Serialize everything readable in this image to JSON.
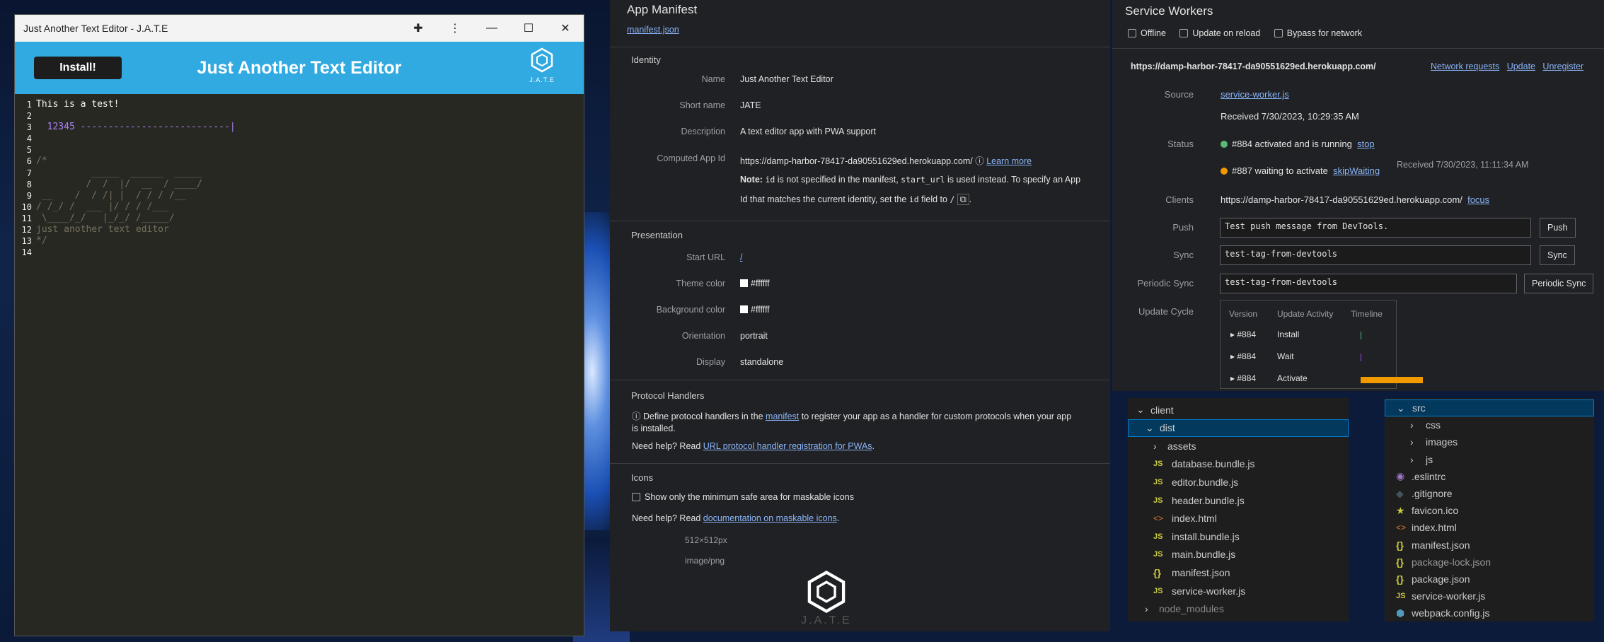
{
  "app": {
    "window_title": "Just Another Text Editor - J.A.T.E",
    "install_label": "Install!",
    "header_title": "Just Another Text Editor",
    "logo_text": "J.A.T.E",
    "lines": [
      {
        "n": "1",
        "text": "This is a test!",
        "cls": "code"
      },
      {
        "n": "2",
        "text": "",
        "cls": "code"
      },
      {
        "n": "3",
        "text": "  12345 ---------------------------|",
        "cls": "c-num"
      },
      {
        "n": "4",
        "text": "",
        "cls": "code"
      },
      {
        "n": "5",
        "text": "",
        "cls": "code"
      },
      {
        "n": "6",
        "text": "/*",
        "cls": "c-com"
      },
      {
        "n": "7",
        "text": "          _____  ______  _____",
        "cls": "c-com"
      },
      {
        "n": "8",
        "text": "         /  /  |/  __  / ____/",
        "cls": "c-com"
      },
      {
        "n": "9",
        "text": " __    /  / /| |  / / / /__",
        "cls": "c-com"
      },
      {
        "n": "10",
        "text": "/ /_/ /  ___ |/ / / /___",
        "cls": "c-com"
      },
      {
        "n": "11",
        "text": " \\____/_/   |_/_/ /_____/",
        "cls": "c-com"
      },
      {
        "n": "12",
        "text": "just another text editor",
        "cls": "c-com"
      },
      {
        "n": "13",
        "text": "*/",
        "cls": "c-com"
      },
      {
        "n": "14",
        "text": "",
        "cls": "code"
      }
    ]
  },
  "manifest": {
    "title": "App Manifest",
    "link": "manifest.json",
    "identity": {
      "heading": "Identity",
      "name_k": "Name",
      "name_v": "Just Another Text Editor",
      "short_k": "Short name",
      "short_v": "JATE",
      "desc_k": "Description",
      "desc_v": "A text editor app with PWA support",
      "appid_k": "Computed App Id",
      "appid_v": "https://damp-harbor-78417-da90551629ed.herokuapp.com/",
      "learn": "Learn more",
      "note_b": "Note:",
      "note_1": " is not specified in the manifest, ",
      "note_2": " is used instead. To specify an App",
      "note_3": "Id that matches the current identity, set the ",
      "note_4": " field to ",
      "note_5": ".",
      "code_id": "id",
      "code_start": "start_url",
      "code_id2": "id",
      "code_slash": "/"
    },
    "presentation": {
      "heading": "Presentation",
      "start_k": "Start URL",
      "start_v": "/",
      "theme_k": "Theme color",
      "theme_v": "#ffffff",
      "bg_k": "Background color",
      "bg_v": "#ffffff",
      "orient_k": "Orientation",
      "orient_v": "portrait",
      "display_k": "Display",
      "display_v": "standalone"
    },
    "protocol": {
      "heading": "Protocol Handlers",
      "line1a": "Define protocol handlers in the ",
      "line1link": "manifest",
      "line1b": " to register your app as a handler for custom protocols when your app",
      "line2": "is installed.",
      "help": "Need help? Read ",
      "helplink": "URL protocol handler registration for PWAs",
      "helpend": "."
    },
    "icons": {
      "heading": "Icons",
      "checkbox": "Show only the minimum safe area for maskable icons",
      "help": "Need help? Read ",
      "helplink": "documentation on maskable icons",
      "helpend": ".",
      "size": "512×512px",
      "type": "image/png",
      "logo_text": "J.A.T.E"
    }
  },
  "sw": {
    "title": "Service Workers",
    "offline": "Offline",
    "update_reload": "Update on reload",
    "bypass": "Bypass for network",
    "origin": "https://damp-harbor-78417-da90551629ed.herokuapp.com/",
    "netreq": "Network requests",
    "update": "Update",
    "unregister": "Unregister",
    "source_k": "Source",
    "source_v": "service-worker.js",
    "received": "Received 7/30/2023, 10:29:35 AM",
    "status_k": "Status",
    "status1": "#884 activated and is running",
    "stop": "stop",
    "status2": "#887 waiting to activate",
    "skip": "skipWaiting",
    "received2": "Received 7/30/2023, 11:11:34 AM",
    "clients_k": "Clients",
    "clients_v": "https://damp-harbor-78417-da90551629ed.herokuapp.com/",
    "focus": "focus",
    "push_k": "Push",
    "push_v": "Test push message from DevTools.",
    "push_btn": "Push",
    "sync_k": "Sync",
    "sync_v": "test-tag-from-devtools",
    "sync_btn": "Sync",
    "psync_k": "Periodic Sync",
    "psync_v": "test-tag-from-devtools",
    "psync_btn": "Periodic Sync",
    "cycle_k": "Update Cycle",
    "cycle_headers": [
      "Version",
      "Update Activity",
      "Timeline"
    ],
    "cycle_rows": [
      {
        "v": "#884",
        "a": "Install"
      },
      {
        "v": "#884",
        "a": "Wait"
      },
      {
        "v": "#884",
        "a": "Activate"
      }
    ],
    "colors": {
      "green": "#5bb974",
      "orange": "#f29900"
    }
  },
  "explorer1": {
    "items": [
      "client",
      "dist",
      "assets",
      "database.bundle.js",
      "editor.bundle.js",
      "header.bundle.js",
      "index.html",
      "install.bundle.js",
      "main.bundle.js",
      "manifest.json",
      "service-worker.js",
      "node_modules"
    ]
  },
  "explorer2": {
    "items": [
      "src",
      "css",
      "images",
      "js",
      ".eslintrc",
      ".gitignore",
      "favicon.ico",
      "index.html",
      "manifest.json",
      "package-lock.json",
      "package.json",
      "service-worker.js",
      "webpack.config.js"
    ]
  }
}
